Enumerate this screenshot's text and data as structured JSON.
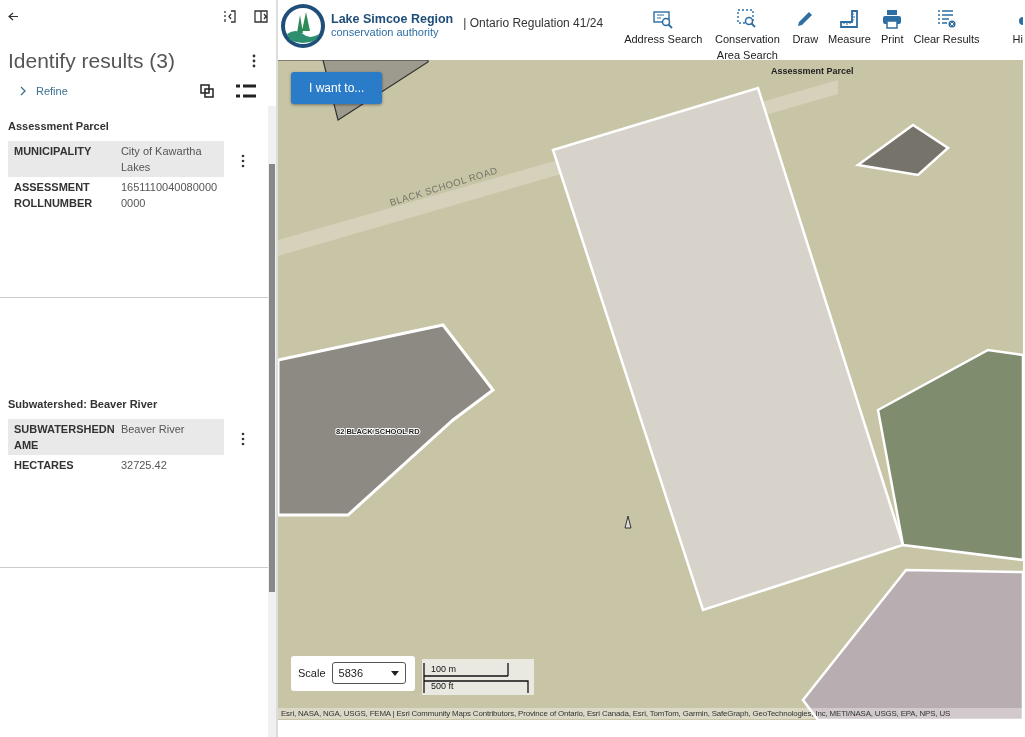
{
  "panel": {
    "title": "Identify results (3)",
    "refine": "Refine",
    "results": [
      {
        "title": "Assessment Parcel",
        "attributes": [
          {
            "name": "MUNICIPALITY",
            "value": "City of Kawartha Lakes"
          },
          {
            "name": "ASSESSMENT ROLLNUMBER",
            "value": "16511100400800000000"
          }
        ]
      },
      {
        "title": "Subwatershed: Beaver River",
        "attributes": [
          {
            "name": "SUBWATERSHEDNAME",
            "value": "Beaver River"
          },
          {
            "name": "HECTARES",
            "value": "32725.42"
          }
        ]
      }
    ]
  },
  "header": {
    "logo_title": "Lake Simcoe Region",
    "logo_subtitle": "conservation authority",
    "regulation": "| Ontario Regulation 41/24",
    "tools": [
      {
        "kind": "address",
        "label": "Address Search"
      },
      {
        "kind": "area",
        "label": "Conservation Area Search"
      },
      {
        "kind": "draw",
        "label": "Draw"
      },
      {
        "kind": "measure",
        "label": "Measure"
      },
      {
        "kind": "print",
        "label": "Print"
      },
      {
        "kind": "clear",
        "label": "Clear Results"
      },
      {
        "kind": "cut",
        "label": "Hi"
      }
    ]
  },
  "map": {
    "menu_button": "I want to...",
    "labels": [
      {
        "kind": "parcel",
        "text": "Assessment Parcel"
      },
      {
        "kind": "road",
        "text": "BLACK SCHOOL ROAD"
      },
      {
        "kind": "address",
        "text": "82 BLACK SCHOOL RD"
      }
    ],
    "scale": {
      "label": "Scale",
      "value": "5836"
    },
    "scale_bar": {
      "metric": "100 m",
      "imperial": "500 ft"
    },
    "attribution": "Esri, NASA, NGA, USGS, FEMA | Esri Community Maps Contributors, Province of Ontario, Esri Canada, Esri, TomTom, Garmin, SafeGraph, GeoTechnologies, Inc, METI/NASA, USGS, EPA, NPS, US"
  }
}
